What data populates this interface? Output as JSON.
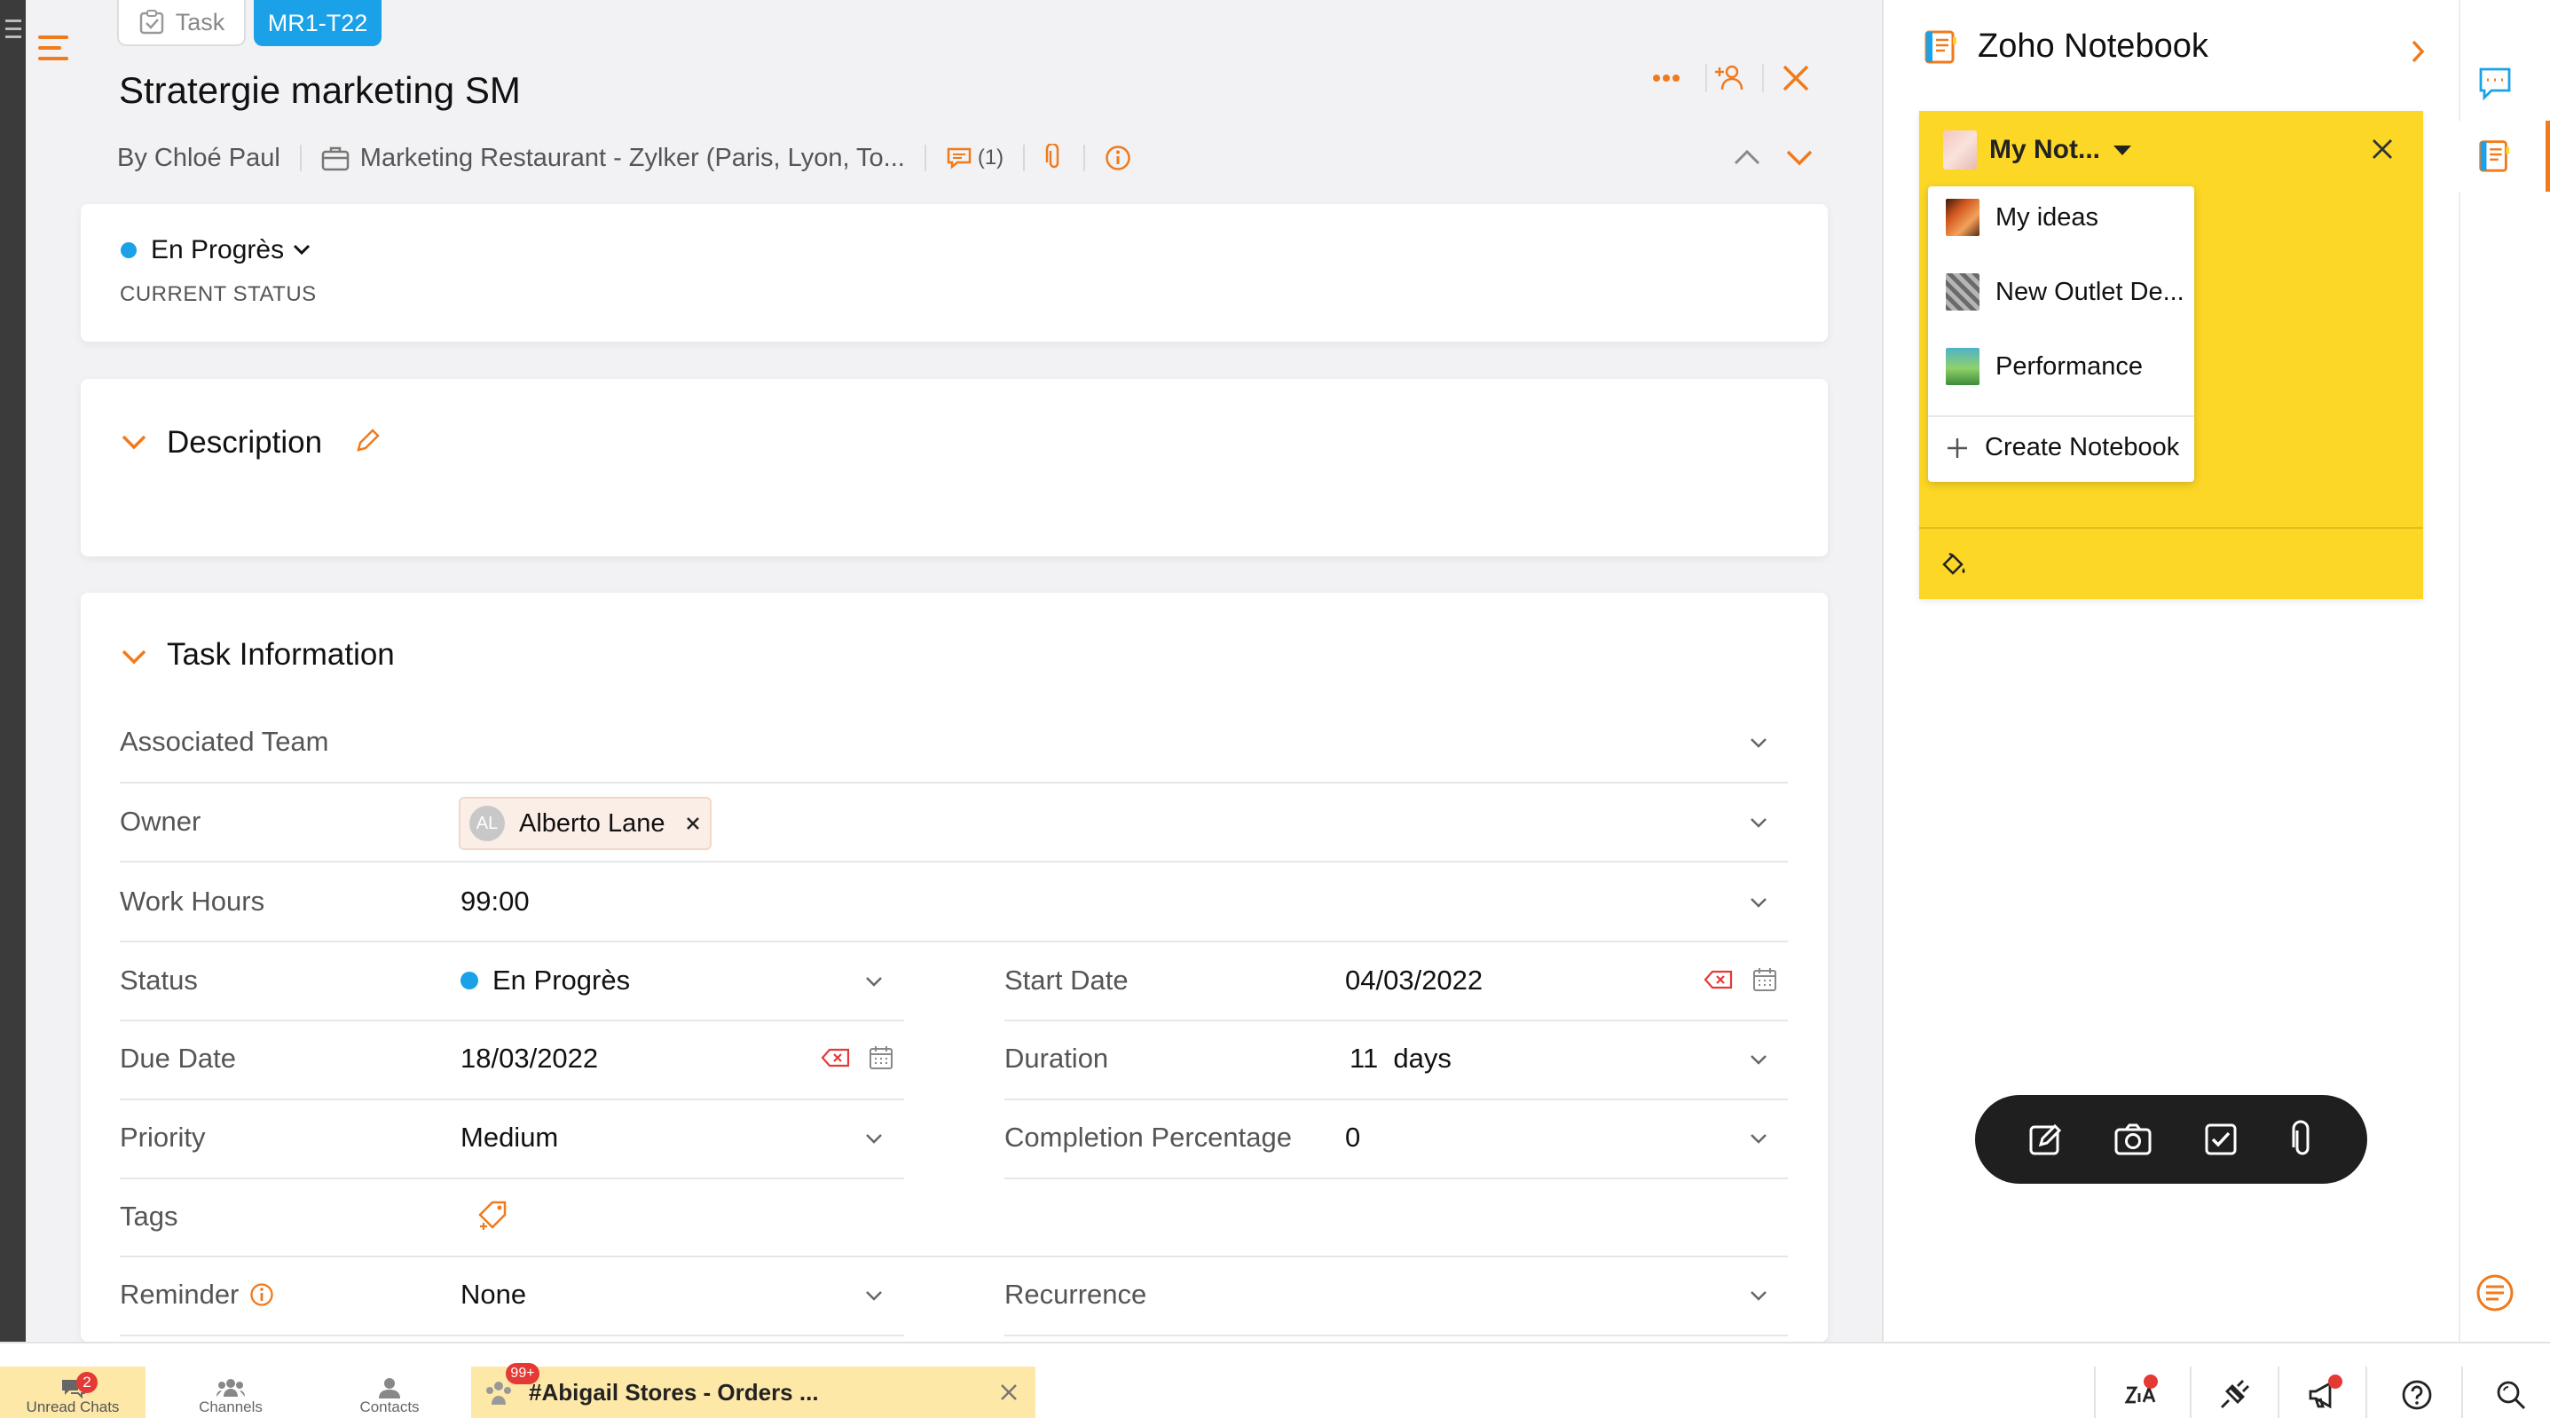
{
  "breadcrumb": {
    "task_label": "Task",
    "task_id": "MR1-T22"
  },
  "task": {
    "title": "Stratergie marketing SM",
    "author": "By Chloé Paul",
    "project": "Marketing Restaurant - Zylker (Paris, Lyon, To...",
    "comment_count": "(1)"
  },
  "status_card": {
    "value": "En Progrès",
    "label": "CURRENT STATUS",
    "dot_color": "#1aa1e8"
  },
  "description": {
    "title": "Description"
  },
  "task_info": {
    "title": "Task Information",
    "associated_team_label": "Associated Team",
    "owner_label": "Owner",
    "owner_initials": "AL",
    "owner_name": "Alberto Lane",
    "work_hours_label": "Work Hours",
    "work_hours_value": "99:00",
    "status_label": "Status",
    "status_value": "En Progrès",
    "start_date_label": "Start Date",
    "start_date_value": "04/03/2022",
    "due_date_label": "Due Date",
    "due_date_value": "18/03/2022",
    "duration_label": "Duration",
    "duration_value": "11  days",
    "priority_label": "Priority",
    "priority_value": "Medium",
    "completion_label": "Completion Percentage",
    "completion_value": "0",
    "tags_label": "Tags",
    "reminder_label": "Reminder",
    "reminder_value": "None",
    "recurrence_label": "Recurrence"
  },
  "notebook": {
    "app_title": "Zoho Notebook",
    "selected_notebook": "My Not...",
    "notebooks": [
      "My ideas",
      "New Outlet De...",
      "Performance"
    ],
    "create_label": "Create Notebook"
  },
  "bottom_bar": {
    "unread_label": "Unread Chats",
    "unread_count": "2",
    "channels_label": "Channels",
    "contacts_label": "Contacts",
    "chat_badge": "99+",
    "chat_title": "#Abigail Stores - Orders ..."
  },
  "colors": {
    "accent": "#f07a1c",
    "blue": "#1aa1e8",
    "notebook_yellow": "#fdd726"
  }
}
